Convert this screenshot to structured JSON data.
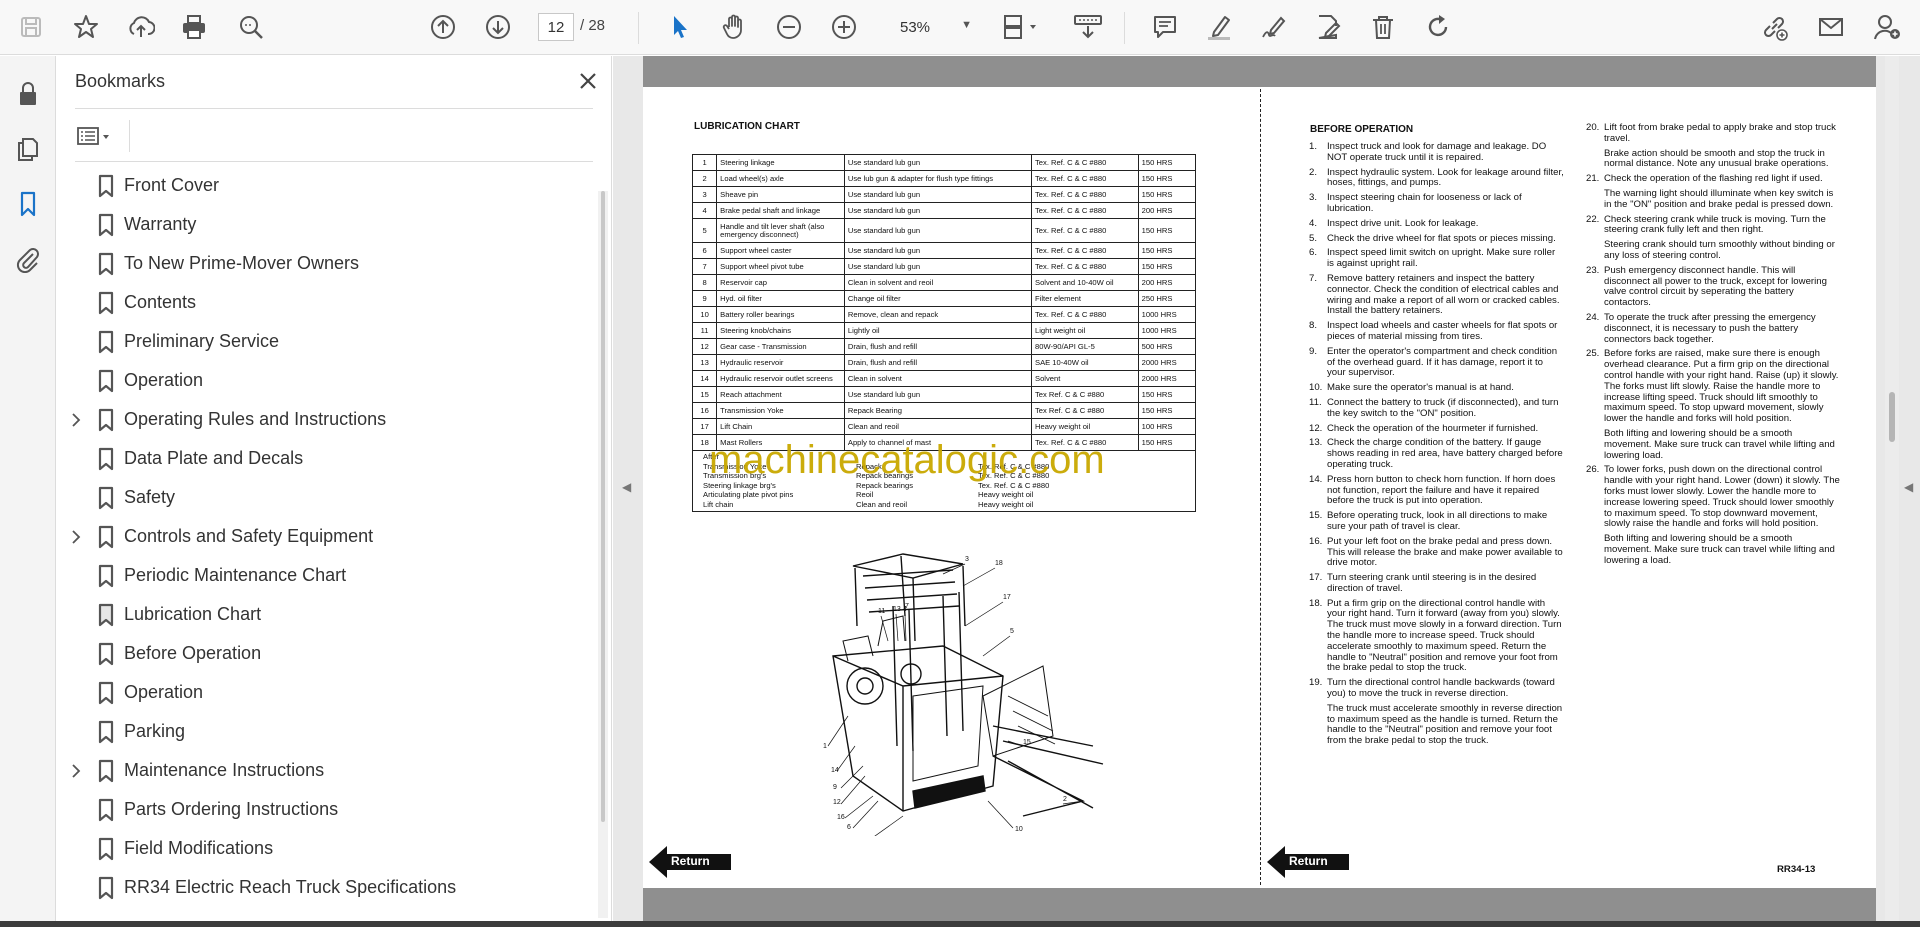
{
  "toolbar": {
    "page_current": "12",
    "page_total": "/  28",
    "zoom": "53%",
    "icons_left": [
      "save-icon",
      "star-icon",
      "upload-icon",
      "print-icon",
      "zoom-search-icon"
    ],
    "icons_nav": [
      "page-up-icon",
      "page-down-icon"
    ],
    "icons_tools": [
      "select-arrow-icon",
      "hand-icon",
      "zoom-out-icon",
      "zoom-in-icon"
    ],
    "icons_right": [
      "comment-icon",
      "highlight-icon",
      "sign-icon",
      "edit-pdf-icon",
      "delete-icon",
      "rotate-icon",
      "share-link-icon",
      "mail-icon",
      "add-user-icon"
    ]
  },
  "colors": {
    "accent": "#1a73c8",
    "watermark": "#c9a800",
    "band": "#8f8f8f"
  },
  "sidebar": {
    "title": "Bookmarks",
    "items": [
      {
        "label": "Front Cover",
        "expandable": false
      },
      {
        "label": "Warranty",
        "expandable": false
      },
      {
        "label": "To New Prime-Mover Owners",
        "expandable": false
      },
      {
        "label": "Contents",
        "expandable": false
      },
      {
        "label": "Preliminary Service",
        "expandable": false
      },
      {
        "label": "Operation",
        "expandable": false
      },
      {
        "label": "Operating Rules and Instructions",
        "expandable": true
      },
      {
        "label": "Data Plate and Decals",
        "expandable": false
      },
      {
        "label": "Safety",
        "expandable": false
      },
      {
        "label": "Controls and Safety Equipment",
        "expandable": true
      },
      {
        "label": "Periodic Maintenance Chart",
        "expandable": false
      },
      {
        "label": "Lubrication Chart",
        "expandable": false,
        "current": true
      },
      {
        "label": "Before Operation",
        "expandable": false
      },
      {
        "label": "Operation",
        "expandable": false
      },
      {
        "label": "Parking",
        "expandable": false
      },
      {
        "label": "Maintenance Instructions",
        "expandable": true
      },
      {
        "label": "Parts Ordering Instructions",
        "expandable": false
      },
      {
        "label": "Field Modifications",
        "expandable": false
      },
      {
        "label": "RR34 Electric Reach Truck Specifications",
        "expandable": false
      }
    ]
  },
  "document": {
    "left_heading": "LUBRICATION CHART",
    "lub_rows": [
      [
        "1",
        "Steering linkage",
        "Use standard lub gun",
        "Tex. Ref. C & C #880",
        "150 HRS"
      ],
      [
        "2",
        "Load wheel(s) axle",
        "Use lub gun & adapter for flush type fittings",
        "Tex. Ref. C & C #880",
        "150 HRS"
      ],
      [
        "3",
        "Sheave pin",
        "Use standard lub gun",
        "Tex. Ref. C & C #880",
        "150 HRS"
      ],
      [
        "4",
        "Brake pedal shaft and linkage",
        "Use standard lub gun",
        "Tex. Ref. C & C #880",
        "200 HRS"
      ],
      [
        "5",
        "Handle and tilt lever shaft (also emergency disconnect)",
        "Use standard lub gun",
        "Tex. Ref. C & C #880",
        "150 HRS"
      ],
      [
        "6",
        "Support wheel caster",
        "Use standard lub gun",
        "Tex. Ref. C & C #880",
        "150 HRS"
      ],
      [
        "7",
        "Support wheel pivot tube",
        "Use standard lub gun",
        "Tex. Ref. C & C #880",
        "150 HRS"
      ],
      [
        "8",
        "Reservoir cap",
        "Clean in solvent and reoil",
        "Solvent and 10-40W oil",
        "200 HRS"
      ],
      [
        "9",
        "Hyd. oil filter",
        "Change oil filter",
        "Filter element",
        "250 HRS"
      ],
      [
        "10",
        "Battery roller bearings",
        "Remove, clean and repack",
        "Tex. Ref. C & C #880",
        "1000 HRS"
      ],
      [
        "11",
        "Steering knob/chains",
        "Lightly oil",
        "Light weight oil",
        "1000 HRS"
      ],
      [
        "12",
        "Gear case - Transmission",
        "Drain, flush and refill",
        "80W-90/API GL-5",
        "500 HRS"
      ],
      [
        "13",
        "Hydraulic reservoir",
        "Drain, flush and refill",
        "SAE 10-40W oil",
        "2000 HRS"
      ],
      [
        "14",
        "Hydraulic reservoir outlet screens",
        "Clean in solvent",
        "Solvent",
        "2000 HRS"
      ],
      [
        "15",
        "Reach attachment",
        "Use standard lub gun",
        "Tex Ref. C & C #880",
        "150 HRS"
      ],
      [
        "16",
        "Transmission Yoke",
        "Repack Bearing",
        "Tex Ref. C & C #880",
        "150 HRS"
      ],
      [
        "17",
        "Lift Chain",
        "Clean and reoil",
        "Heavy weight oil",
        "100 HRS"
      ],
      [
        "18",
        "Mast Rollers",
        "Apply to channel of mast",
        "Tex. Ref. C & C #880",
        "150 HRS"
      ]
    ],
    "after_lines": [
      [
        "After",
        "",
        ""
      ],
      [
        "Transmission Yoke",
        "Repack",
        "Tex. Ref. C & C #880"
      ],
      [
        "Transmission brg's",
        "Repack bearings",
        "Tex. Ref. C & C #880"
      ],
      [
        "Steering linkage brg's",
        "Repack bearings",
        "Tex. Ref. C & C #880"
      ],
      [
        "Articulating plate pivot pins",
        "Reoil",
        "Heavy weight oil"
      ],
      [
        "Lift chain",
        "Clean and reoil",
        "Heavy weight oil"
      ]
    ],
    "callouts": [
      "3",
      "18",
      "17",
      "11",
      "13",
      "4",
      "5",
      "1",
      "15",
      "14",
      "9",
      "12",
      "16",
      "6",
      "2",
      "8",
      "10",
      "7"
    ],
    "return_label": "Return",
    "right_heading": "BEFORE OPERATION",
    "steps_col1": [
      {
        "n": "1.",
        "text": "Inspect truck and look for damage and leakage. DO NOT operate truck until it is repaired."
      },
      {
        "n": "2.",
        "text": "Inspect hydraulic system. Look for leakage around filter, hoses, fittings, and pumps."
      },
      {
        "n": "3.",
        "text": "Inspect steering chain for looseness or lack of lubrication."
      },
      {
        "n": "4.",
        "text": "Inspect drive unit. Look for leakage."
      },
      {
        "n": "5.",
        "text": "Check the drive wheel for flat spots or pieces missing."
      },
      {
        "n": "6.",
        "text": "Inspect speed limit switch on upright. Make sure roller is against upright rail."
      },
      {
        "n": "7.",
        "text": "Remove battery retainers and inspect the battery connector. Check the condition of electrical cables and wiring and make a report of all worn or cracked cables. Install the battery retainers."
      },
      {
        "n": "8.",
        "text": "Inspect load wheels and caster wheels for flat spots or pieces of material missing from tires."
      },
      {
        "n": "9.",
        "text": "Enter the operator's compartment and check condition of the overhead guard. If it has damage, report it to your supervisor."
      },
      {
        "n": "10.",
        "text": "Make sure the operator's manual is at hand."
      },
      {
        "n": "11.",
        "text": "Connect the battery to truck (if disconnected), and turn the key switch to the \"ON\" position."
      },
      {
        "n": "12.",
        "text": "Check the operation of the hourmeter if furnished."
      },
      {
        "n": "13.",
        "text": "Check the charge condition of the battery. If gauge shows reading in red area, have battery charged before operating truck."
      },
      {
        "n": "14.",
        "text": "Press horn button to check horn function. If horn does not function, report the failure and have it repaired before the truck is put into operation."
      },
      {
        "n": "15.",
        "text": "Before operating truck, look in all directions to make sure your path of travel is clear."
      },
      {
        "n": "16.",
        "text": "Put your left foot on the brake pedal and press down. This will release the brake and make power available to drive motor."
      },
      {
        "n": "17.",
        "text": "Turn steering crank until steering is in the desired direction of travel."
      },
      {
        "n": "18.",
        "text": "Put a firm grip on the directional control handle with your right hand. Turn it forward (away from you) slowly. The truck must move slowly in a forward direction. Turn the handle more to increase speed. Truck should accelerate smoothly to maximum speed. Return the handle to \"Neutral\" position and remove your foot from the brake pedal to stop the truck."
      },
      {
        "n": "19.",
        "text": "Turn the directional control handle backwards (toward you) to move the truck in reverse direction."
      },
      {
        "n": "",
        "text": "The truck must accelerate smoothly in reverse direction to maximum speed as the handle is turned. Return the handle to the \"Neutral\" position and remove your foot from the brake pedal to stop the truck."
      }
    ],
    "steps_col2": [
      {
        "n": "20.",
        "text": "Lift foot from brake pedal to apply brake and stop truck travel."
      },
      {
        "n": "",
        "text": "Brake action should be smooth and stop the truck in normal distance. Note any unusual brake operations."
      },
      {
        "n": "21.",
        "text": "Check the operation of the flashing red light if used."
      },
      {
        "n": "",
        "text": "The warning light should illuminate when key switch is in the \"ON\" position and brake pedal is pressed down."
      },
      {
        "n": "22.",
        "text": "Check steering crank while truck is moving. Turn the steering crank fully left and then right."
      },
      {
        "n": "",
        "text": "Steering crank should turn smoothly without binding or any loss of steering control."
      },
      {
        "n": "23.",
        "text": "Push emergency disconnect handle. This will disconnect all power to the truck, except for lowering valve control circuit by seperating the battery contactors."
      },
      {
        "n": "24.",
        "text": "To operate the truck after pressing the emergency disconnect, it is necessary to push the battery connectors back together."
      },
      {
        "n": "25.",
        "text": "Before forks are raised, make sure there is enough overhead clearance. Put a firm grip on the directional control handle with your right hand. Raise (up) it slowly. The forks must lift slowly. Raise the handle more to increase lifting speed. Truck should lift smoothly to maximum speed. To stop upward movement, slowly lower the handle and forks will hold position."
      },
      {
        "n": "",
        "text": "Both lifting and lowering should be a smooth movement. Make sure truck can travel while lifting and lowering load."
      },
      {
        "n": "26.",
        "text": "To lower forks, push down on the directional control handle with your right hand. Lower (down) it slowly. The forks must lower slowly. Lower the handle more to increase lowering speed. Truck should lower smoothly to maximum speed. To stop downward movement, slowly raise the handle and forks will hold position."
      },
      {
        "n": "",
        "text": "Both lifting and lowering should be a smooth movement. Make sure truck can travel while lifting and lowering a load."
      }
    ],
    "page_id": "RR34-13",
    "watermark": "machinecatalogic.com"
  }
}
